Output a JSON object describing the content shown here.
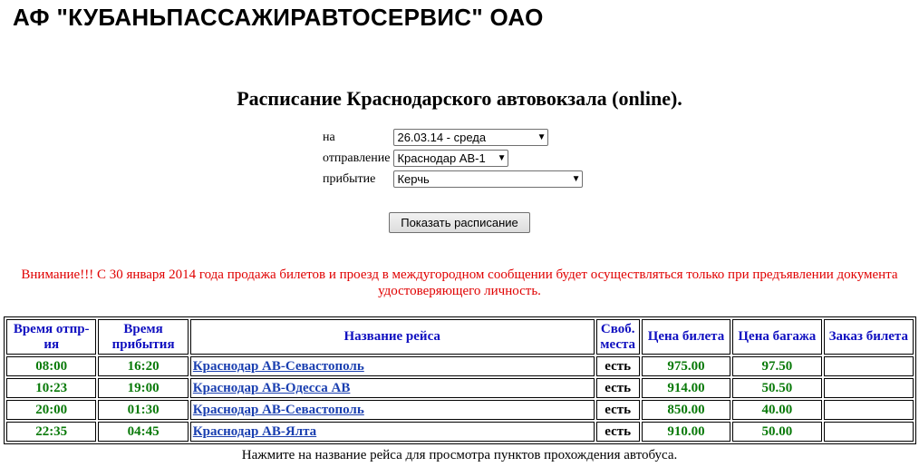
{
  "header": {
    "company": "АФ \"КУБАНЬПАССАЖИРАВТОСЕРВИС\" ОАО",
    "subtitle": "Расписание Краснодарского автовокзала (online)."
  },
  "form": {
    "date_label": "на",
    "date_value": "26.03.14 - среда",
    "departure_label": "отправление",
    "departure_value": "Краснодар АВ-1",
    "arrival_label": "прибытие",
    "arrival_value": "Керчь",
    "show_button": "Показать расписание"
  },
  "warning": "Внимание!!! С 30 января 2014 года продажа билетов и проезд в междугородном сообщении будет осуществляться только при предъявлении документа удостоверяющего личность.",
  "table": {
    "headers": [
      "Время отпр-ия",
      "Время прибытия",
      "Название рейса",
      "Своб. места",
      "Цена билета",
      "Цена багажа",
      "Заказ билета"
    ],
    "rows": [
      {
        "dep": "08:00",
        "arr": "16:20",
        "route": "Краснодар АВ-Севастополь",
        "seats": "есть",
        "price": "975.00",
        "luggage": "97.50",
        "order": ""
      },
      {
        "dep": "10:23",
        "arr": "19:00",
        "route": "Краснодар АВ-Одесса АВ",
        "seats": "есть",
        "price": "914.00",
        "luggage": "50.50",
        "order": ""
      },
      {
        "dep": "20:00",
        "arr": "01:30",
        "route": "Краснодар АВ-Севастополь",
        "seats": "есть",
        "price": "850.00",
        "luggage": "40.00",
        "order": ""
      },
      {
        "dep": "22:35",
        "arr": "04:45",
        "route": "Краснодар АВ-Ялта",
        "seats": "есть",
        "price": "910.00",
        "luggage": "50.00",
        "order": ""
      }
    ]
  },
  "note": "Нажмите на название рейса для просмотра пунктов прохождения автобуса.",
  "colors": {
    "warning": "#e00000",
    "header_text": "#1010c0",
    "time_text": "#0a7a0a",
    "link": "#1a3fb0"
  }
}
